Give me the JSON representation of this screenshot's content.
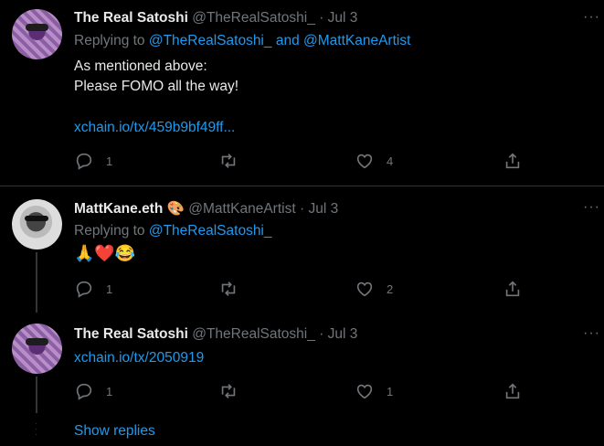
{
  "tweets": [
    {
      "name": "The Real Satoshi",
      "handle": "@TheRealSatoshi_",
      "dot": "·",
      "date": "Jul 3",
      "replying_prefix": "Replying to",
      "replying_to_1": "@TheRealSatoshi_",
      "replying_and": "and",
      "replying_to_2": "@MattKaneArtist",
      "text_line1": "As mentioned above:",
      "text_line2": "Please FOMO all the way!",
      "link": "xchain.io/tx/459b9bf49ff...",
      "replies": "1",
      "retweets": "",
      "likes": "4"
    },
    {
      "name": "MattKane.eth",
      "name_emoji": "🎨",
      "handle": "@MattKaneArtist",
      "dot": "·",
      "date": "Jul 3",
      "replying_prefix": "Replying to",
      "replying_to_1": "@TheRealSatoshi_",
      "emojis": "🙏❤️😂",
      "replies": "1",
      "retweets": "",
      "likes": "2"
    },
    {
      "name": "The Real Satoshi",
      "handle": "@TheRealSatoshi_",
      "dot": "·",
      "date": "Jul 3",
      "link": "xchain.io/tx/2050919",
      "replies": "1",
      "retweets": "",
      "likes": "1"
    }
  ],
  "more_label": "···",
  "show_replies": "Show replies",
  "icons": [
    "reply-icon",
    "retweet-icon",
    "like-icon",
    "share-icon",
    "more-icon"
  ]
}
